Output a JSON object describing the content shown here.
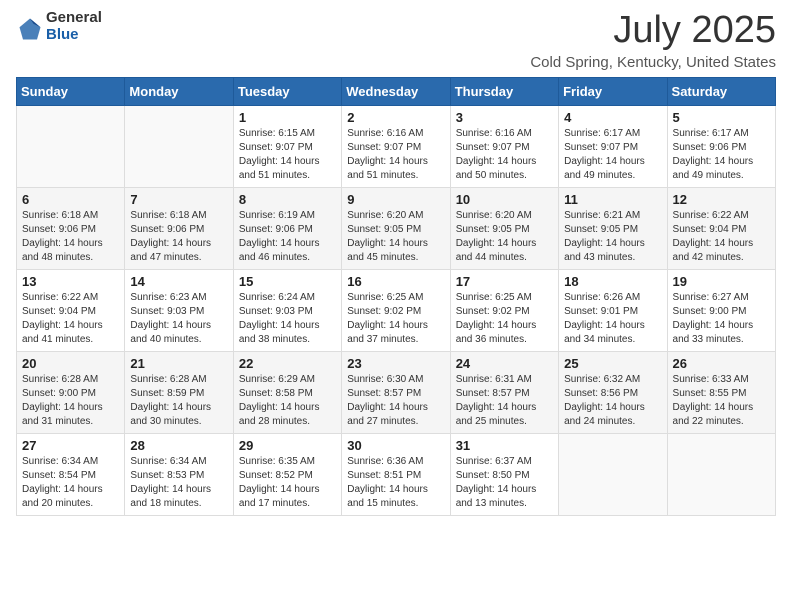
{
  "header": {
    "logo_general": "General",
    "logo_blue": "Blue",
    "title": "July 2025",
    "subtitle": "Cold Spring, Kentucky, United States"
  },
  "calendar": {
    "days_of_week": [
      "Sunday",
      "Monday",
      "Tuesday",
      "Wednesday",
      "Thursday",
      "Friday",
      "Saturday"
    ],
    "weeks": [
      [
        {
          "day": "",
          "info": ""
        },
        {
          "day": "",
          "info": ""
        },
        {
          "day": "1",
          "info": "Sunrise: 6:15 AM\nSunset: 9:07 PM\nDaylight: 14 hours and 51 minutes."
        },
        {
          "day": "2",
          "info": "Sunrise: 6:16 AM\nSunset: 9:07 PM\nDaylight: 14 hours and 51 minutes."
        },
        {
          "day": "3",
          "info": "Sunrise: 6:16 AM\nSunset: 9:07 PM\nDaylight: 14 hours and 50 minutes."
        },
        {
          "day": "4",
          "info": "Sunrise: 6:17 AM\nSunset: 9:07 PM\nDaylight: 14 hours and 49 minutes."
        },
        {
          "day": "5",
          "info": "Sunrise: 6:17 AM\nSunset: 9:06 PM\nDaylight: 14 hours and 49 minutes."
        }
      ],
      [
        {
          "day": "6",
          "info": "Sunrise: 6:18 AM\nSunset: 9:06 PM\nDaylight: 14 hours and 48 minutes."
        },
        {
          "day": "7",
          "info": "Sunrise: 6:18 AM\nSunset: 9:06 PM\nDaylight: 14 hours and 47 minutes."
        },
        {
          "day": "8",
          "info": "Sunrise: 6:19 AM\nSunset: 9:06 PM\nDaylight: 14 hours and 46 minutes."
        },
        {
          "day": "9",
          "info": "Sunrise: 6:20 AM\nSunset: 9:05 PM\nDaylight: 14 hours and 45 minutes."
        },
        {
          "day": "10",
          "info": "Sunrise: 6:20 AM\nSunset: 9:05 PM\nDaylight: 14 hours and 44 minutes."
        },
        {
          "day": "11",
          "info": "Sunrise: 6:21 AM\nSunset: 9:05 PM\nDaylight: 14 hours and 43 minutes."
        },
        {
          "day": "12",
          "info": "Sunrise: 6:22 AM\nSunset: 9:04 PM\nDaylight: 14 hours and 42 minutes."
        }
      ],
      [
        {
          "day": "13",
          "info": "Sunrise: 6:22 AM\nSunset: 9:04 PM\nDaylight: 14 hours and 41 minutes."
        },
        {
          "day": "14",
          "info": "Sunrise: 6:23 AM\nSunset: 9:03 PM\nDaylight: 14 hours and 40 minutes."
        },
        {
          "day": "15",
          "info": "Sunrise: 6:24 AM\nSunset: 9:03 PM\nDaylight: 14 hours and 38 minutes."
        },
        {
          "day": "16",
          "info": "Sunrise: 6:25 AM\nSunset: 9:02 PM\nDaylight: 14 hours and 37 minutes."
        },
        {
          "day": "17",
          "info": "Sunrise: 6:25 AM\nSunset: 9:02 PM\nDaylight: 14 hours and 36 minutes."
        },
        {
          "day": "18",
          "info": "Sunrise: 6:26 AM\nSunset: 9:01 PM\nDaylight: 14 hours and 34 minutes."
        },
        {
          "day": "19",
          "info": "Sunrise: 6:27 AM\nSunset: 9:00 PM\nDaylight: 14 hours and 33 minutes."
        }
      ],
      [
        {
          "day": "20",
          "info": "Sunrise: 6:28 AM\nSunset: 9:00 PM\nDaylight: 14 hours and 31 minutes."
        },
        {
          "day": "21",
          "info": "Sunrise: 6:28 AM\nSunset: 8:59 PM\nDaylight: 14 hours and 30 minutes."
        },
        {
          "day": "22",
          "info": "Sunrise: 6:29 AM\nSunset: 8:58 PM\nDaylight: 14 hours and 28 minutes."
        },
        {
          "day": "23",
          "info": "Sunrise: 6:30 AM\nSunset: 8:57 PM\nDaylight: 14 hours and 27 minutes."
        },
        {
          "day": "24",
          "info": "Sunrise: 6:31 AM\nSunset: 8:57 PM\nDaylight: 14 hours and 25 minutes."
        },
        {
          "day": "25",
          "info": "Sunrise: 6:32 AM\nSunset: 8:56 PM\nDaylight: 14 hours and 24 minutes."
        },
        {
          "day": "26",
          "info": "Sunrise: 6:33 AM\nSunset: 8:55 PM\nDaylight: 14 hours and 22 minutes."
        }
      ],
      [
        {
          "day": "27",
          "info": "Sunrise: 6:34 AM\nSunset: 8:54 PM\nDaylight: 14 hours and 20 minutes."
        },
        {
          "day": "28",
          "info": "Sunrise: 6:34 AM\nSunset: 8:53 PM\nDaylight: 14 hours and 18 minutes."
        },
        {
          "day": "29",
          "info": "Sunrise: 6:35 AM\nSunset: 8:52 PM\nDaylight: 14 hours and 17 minutes."
        },
        {
          "day": "30",
          "info": "Sunrise: 6:36 AM\nSunset: 8:51 PM\nDaylight: 14 hours and 15 minutes."
        },
        {
          "day": "31",
          "info": "Sunrise: 6:37 AM\nSunset: 8:50 PM\nDaylight: 14 hours and 13 minutes."
        },
        {
          "day": "",
          "info": ""
        },
        {
          "day": "",
          "info": ""
        }
      ]
    ]
  }
}
